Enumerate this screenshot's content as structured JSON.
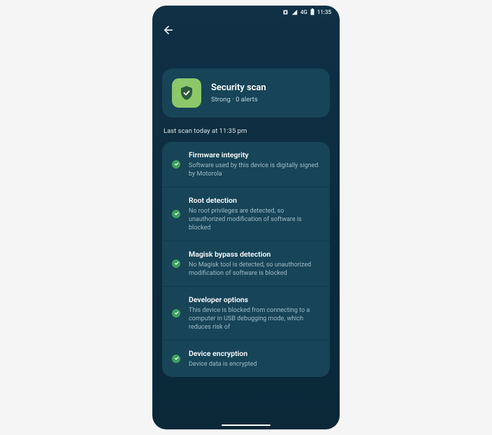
{
  "status_bar": {
    "network_label": "4G",
    "time": "11:35"
  },
  "hero": {
    "title": "Security scan",
    "subtitle": "Strong · 0 alerts"
  },
  "last_scan": "Last scan today at 11:35 pm",
  "items": [
    {
      "title": "Firmware integrity",
      "desc": "Software used by this device is digitally signed by Motorola"
    },
    {
      "title": "Root detection",
      "desc": "No root privileges are detected, so unauthorized modification of software is blocked"
    },
    {
      "title": "Magisk bypass detection",
      "desc": "No Magisk tool is detected, so unauthorized modification of software is blocked"
    },
    {
      "title": "Developer options",
      "desc": "This device is blocked from connecting to a computer in USB debugging mode, which reduces risk of"
    },
    {
      "title": "Device encryption",
      "desc": "Device data is encrypted"
    }
  ]
}
